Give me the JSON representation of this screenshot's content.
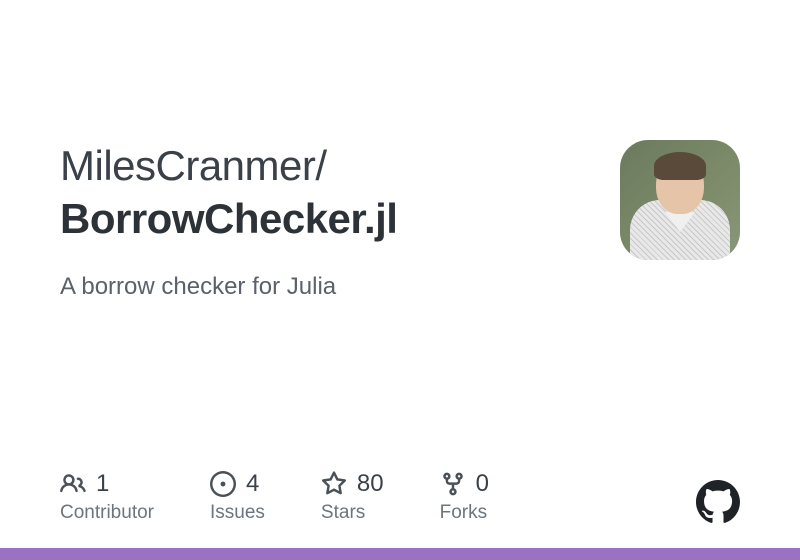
{
  "repo": {
    "owner": "MilesCranmer",
    "separator": "/",
    "name": "BorrowChecker.jl",
    "description": "A borrow checker for Julia"
  },
  "stats": {
    "contributors": {
      "count": "1",
      "label": "Contributor"
    },
    "issues": {
      "count": "4",
      "label": "Issues"
    },
    "stars": {
      "count": "80",
      "label": "Stars"
    },
    "forks": {
      "count": "0",
      "label": "Forks"
    }
  },
  "colors": {
    "accent": "#9b72c2"
  }
}
